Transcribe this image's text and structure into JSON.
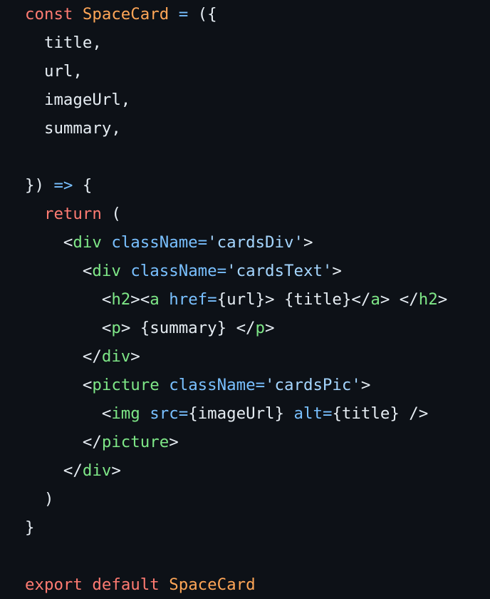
{
  "code": {
    "language": "jsx",
    "colors": {
      "background": "#0d1117",
      "plain": "#e6edf3",
      "keyword": "#ff7b72",
      "entity": "#ffa657",
      "attribute": "#79c0ff",
      "tag": "#7ee787",
      "string": "#a5d6ff",
      "operator": "#79c0ff"
    },
    "lines": [
      [
        {
          "t": "const",
          "k": "keyword"
        },
        {
          "t": " ",
          "k": "plain"
        },
        {
          "t": "SpaceCard",
          "k": "entity"
        },
        {
          "t": " ",
          "k": "plain"
        },
        {
          "t": "=",
          "k": "operator"
        },
        {
          "t": " ({",
          "k": "plain"
        }
      ],
      [
        {
          "t": "  title,",
          "k": "plain"
        }
      ],
      [
        {
          "t": "  url,",
          "k": "plain"
        }
      ],
      [
        {
          "t": "  imageUrl,",
          "k": "plain"
        }
      ],
      [
        {
          "t": "  summary,",
          "k": "plain"
        }
      ],
      [],
      [
        {
          "t": "}) ",
          "k": "plain"
        },
        {
          "t": "=>",
          "k": "operator"
        },
        {
          "t": " {",
          "k": "plain"
        }
      ],
      [
        {
          "t": "  ",
          "k": "plain"
        },
        {
          "t": "return",
          "k": "keyword"
        },
        {
          "t": " (",
          "k": "plain"
        }
      ],
      [
        {
          "t": "    <",
          "k": "plain"
        },
        {
          "t": "div",
          "k": "tag"
        },
        {
          "t": " ",
          "k": "plain"
        },
        {
          "t": "className",
          "k": "attribute"
        },
        {
          "t": "=",
          "k": "operator"
        },
        {
          "t": "'cardsDiv'",
          "k": "string"
        },
        {
          "t": ">",
          "k": "plain"
        }
      ],
      [
        {
          "t": "      <",
          "k": "plain"
        },
        {
          "t": "div",
          "k": "tag"
        },
        {
          "t": " ",
          "k": "plain"
        },
        {
          "t": "className",
          "k": "attribute"
        },
        {
          "t": "=",
          "k": "operator"
        },
        {
          "t": "'cardsText'",
          "k": "string"
        },
        {
          "t": ">",
          "k": "plain"
        }
      ],
      [
        {
          "t": "        <",
          "k": "plain"
        },
        {
          "t": "h2",
          "k": "tag"
        },
        {
          "t": "><",
          "k": "plain"
        },
        {
          "t": "a",
          "k": "tag"
        },
        {
          "t": " ",
          "k": "plain"
        },
        {
          "t": "href",
          "k": "attribute"
        },
        {
          "t": "=",
          "k": "operator"
        },
        {
          "t": "{url}> {title}</",
          "k": "plain"
        },
        {
          "t": "a",
          "k": "tag"
        },
        {
          "t": "> </",
          "k": "plain"
        },
        {
          "t": "h2",
          "k": "tag"
        },
        {
          "t": ">",
          "k": "plain"
        }
      ],
      [
        {
          "t": "        <",
          "k": "plain"
        },
        {
          "t": "p",
          "k": "tag"
        },
        {
          "t": "> {summary} </",
          "k": "plain"
        },
        {
          "t": "p",
          "k": "tag"
        },
        {
          "t": ">",
          "k": "plain"
        }
      ],
      [
        {
          "t": "      </",
          "k": "plain"
        },
        {
          "t": "div",
          "k": "tag"
        },
        {
          "t": ">",
          "k": "plain"
        }
      ],
      [
        {
          "t": "      <",
          "k": "plain"
        },
        {
          "t": "picture",
          "k": "tag"
        },
        {
          "t": " ",
          "k": "plain"
        },
        {
          "t": "className",
          "k": "attribute"
        },
        {
          "t": "=",
          "k": "operator"
        },
        {
          "t": "'cardsPic'",
          "k": "string"
        },
        {
          "t": ">",
          "k": "plain"
        }
      ],
      [
        {
          "t": "        <",
          "k": "plain"
        },
        {
          "t": "img",
          "k": "tag"
        },
        {
          "t": " ",
          "k": "plain"
        },
        {
          "t": "src",
          "k": "attribute"
        },
        {
          "t": "=",
          "k": "operator"
        },
        {
          "t": "{imageUrl} ",
          "k": "plain"
        },
        {
          "t": "alt",
          "k": "attribute"
        },
        {
          "t": "=",
          "k": "operator"
        },
        {
          "t": "{title} />",
          "k": "plain"
        }
      ],
      [
        {
          "t": "      </",
          "k": "plain"
        },
        {
          "t": "picture",
          "k": "tag"
        },
        {
          "t": ">",
          "k": "plain"
        }
      ],
      [
        {
          "t": "    </",
          "k": "plain"
        },
        {
          "t": "div",
          "k": "tag"
        },
        {
          "t": ">",
          "k": "plain"
        }
      ],
      [
        {
          "t": "  )",
          "k": "plain"
        }
      ],
      [
        {
          "t": "}",
          "k": "plain"
        }
      ],
      [],
      [
        {
          "t": "export",
          "k": "keyword"
        },
        {
          "t": " ",
          "k": "plain"
        },
        {
          "t": "default",
          "k": "keyword"
        },
        {
          "t": " ",
          "k": "plain"
        },
        {
          "t": "SpaceCard",
          "k": "entity"
        }
      ]
    ]
  }
}
